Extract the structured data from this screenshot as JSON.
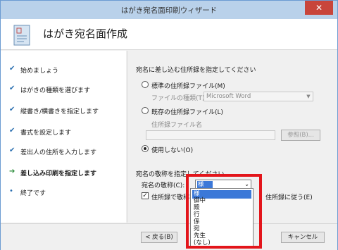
{
  "window": {
    "title": "はがき宛名面印刷ウィザード",
    "close_label": "✕"
  },
  "header": {
    "title": "はがき宛名面作成"
  },
  "steps": [
    {
      "label": "始めましょう",
      "mark": "✔"
    },
    {
      "label": "はがきの種類を選びます",
      "mark": "✔"
    },
    {
      "label": "縦書き/横書きを指定します",
      "mark": "✔"
    },
    {
      "label": "書式を設定します",
      "mark": "✔"
    },
    {
      "label": "差出人の住所を入力します",
      "mark": "✔"
    },
    {
      "label": "差し込み印刷を指定します",
      "mark": "➔"
    },
    {
      "label": "終了です",
      "mark": "•"
    }
  ],
  "address_section": {
    "heading": "宛名に差し込む住所録を指定してください",
    "option_standard": "標準の住所録ファイル(M)",
    "file_type_label": "ファイルの種類(T):",
    "file_type_value": "Microsoft Word",
    "option_existing": "既存の住所録ファイル(L)",
    "file_name_label": "住所録ファイル名",
    "file_name_value": "",
    "browse_label": "参照(B)...",
    "option_none": "使用しない(O)"
  },
  "honorific_section": {
    "heading": "宛名の敬称を指定してください",
    "honorific_label": "宛名の敬称(C):",
    "honorific_value": "様",
    "checkbox_left": "住所録で敬称",
    "checkbox_right": "住所録に従う(E)",
    "checkbox_mark": "✓",
    "options": [
      "様",
      "御中",
      "殿",
      "行",
      "係",
      "宛",
      "先生",
      "(なし)"
    ]
  },
  "footer": {
    "back_label": "< 戻る(B)",
    "cancel_label": "キャンセル"
  }
}
